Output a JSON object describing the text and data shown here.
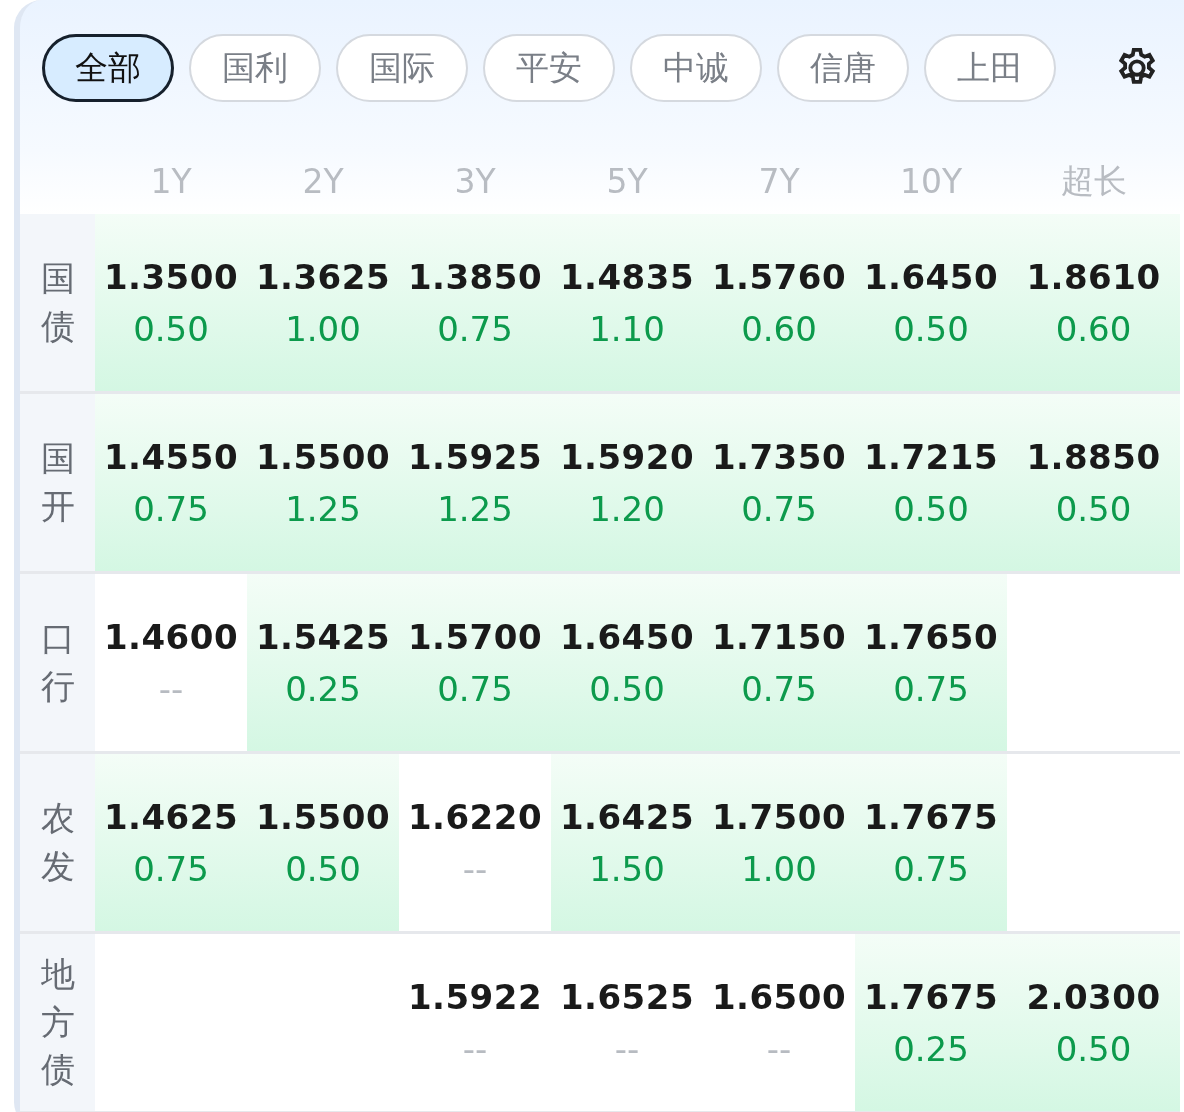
{
  "tabs": [
    {
      "label": "全部",
      "selected": true
    },
    {
      "label": "国利",
      "selected": false
    },
    {
      "label": "国际",
      "selected": false
    },
    {
      "label": "平安",
      "selected": false
    },
    {
      "label": "中诚",
      "selected": false
    },
    {
      "label": "信唐",
      "selected": false
    },
    {
      "label": "上田",
      "selected": false
    }
  ],
  "columns": [
    "1Y",
    "2Y",
    "3Y",
    "5Y",
    "7Y",
    "10Y",
    "超长"
  ],
  "rows": [
    {
      "label": "国债",
      "cells": [
        {
          "rate": "1.3500",
          "change": "0.50",
          "highlighted": true
        },
        {
          "rate": "1.3625",
          "change": "1.00",
          "highlighted": true
        },
        {
          "rate": "1.3850",
          "change": "0.75",
          "highlighted": true
        },
        {
          "rate": "1.4835",
          "change": "1.10",
          "highlighted": true
        },
        {
          "rate": "1.5760",
          "change": "0.60",
          "highlighted": true
        },
        {
          "rate": "1.6450",
          "change": "0.50",
          "highlighted": true
        },
        {
          "rate": "1.8610",
          "change": "0.60",
          "highlighted": true
        }
      ]
    },
    {
      "label": "国开",
      "cells": [
        {
          "rate": "1.4550",
          "change": "0.75",
          "highlighted": true
        },
        {
          "rate": "1.5500",
          "change": "1.25",
          "highlighted": true
        },
        {
          "rate": "1.5925",
          "change": "1.25",
          "highlighted": true
        },
        {
          "rate": "1.5920",
          "change": "1.20",
          "highlighted": true
        },
        {
          "rate": "1.7350",
          "change": "0.75",
          "highlighted": true
        },
        {
          "rate": "1.7215",
          "change": "0.50",
          "highlighted": true
        },
        {
          "rate": "1.8850",
          "change": "0.50",
          "highlighted": true
        }
      ]
    },
    {
      "label": "口行",
      "cells": [
        {
          "rate": "1.4600",
          "change": "--",
          "highlighted": false
        },
        {
          "rate": "1.5425",
          "change": "0.25",
          "highlighted": true
        },
        {
          "rate": "1.5700",
          "change": "0.75",
          "highlighted": true
        },
        {
          "rate": "1.6450",
          "change": "0.50",
          "highlighted": true
        },
        {
          "rate": "1.7150",
          "change": "0.75",
          "highlighted": true
        },
        {
          "rate": "1.7650",
          "change": "0.75",
          "highlighted": true
        },
        {
          "highlighted": false
        }
      ]
    },
    {
      "label": "农发",
      "cells": [
        {
          "rate": "1.4625",
          "change": "0.75",
          "highlighted": true
        },
        {
          "rate": "1.5500",
          "change": "0.50",
          "highlighted": true
        },
        {
          "rate": "1.6220",
          "change": "--",
          "highlighted": false
        },
        {
          "rate": "1.6425",
          "change": "1.50",
          "highlighted": true
        },
        {
          "rate": "1.7500",
          "change": "1.00",
          "highlighted": true
        },
        {
          "rate": "1.7675",
          "change": "0.75",
          "highlighted": true
        },
        {
          "highlighted": false
        }
      ]
    },
    {
      "label": "地方债",
      "cells": [
        {
          "highlighted": false
        },
        {
          "highlighted": false
        },
        {
          "rate": "1.5922",
          "change": "--",
          "highlighted": false
        },
        {
          "rate": "1.6525",
          "change": "--",
          "highlighted": false
        },
        {
          "rate": "1.6500",
          "change": "--",
          "highlighted": false
        },
        {
          "rate": "1.7675",
          "change": "0.25",
          "highlighted": true
        },
        {
          "rate": "2.0300",
          "change": "0.50",
          "highlighted": true
        }
      ]
    }
  ]
}
